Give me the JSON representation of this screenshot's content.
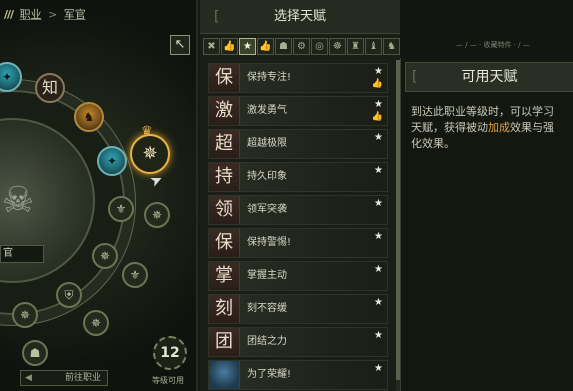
{
  "breadcrumb": {
    "prefix": "///",
    "level1": "职业",
    "separator": ">",
    "level2": "军官"
  },
  "wheel": {
    "rank_label": "官",
    "level_badge": "12",
    "level_caption": "等级可用",
    "prev_button": "前往职业",
    "nodes": {
      "know": "知"
    }
  },
  "choose_panel": {
    "title": "选择天赋",
    "sort_label": "— / — · 收藏特件 · / —",
    "filters": [
      "✖",
      "👍",
      "★",
      "👍",
      "☗",
      "⚙",
      "◎",
      "☸",
      "♜",
      "♝",
      "♞"
    ],
    "talents": [
      {
        "glyph": "保",
        "name": "保持专注!",
        "star": true,
        "thumb": true
      },
      {
        "glyph": "激",
        "name": "激发勇气",
        "star": true,
        "thumb": true
      },
      {
        "glyph": "超",
        "name": "超越极限",
        "star": true,
        "thumb": false
      },
      {
        "glyph": "持",
        "name": "持久印象",
        "star": true,
        "thumb": false
      },
      {
        "glyph": "领",
        "name": "领军突袭",
        "star": true,
        "thumb": false
      },
      {
        "glyph": "保",
        "name": "保持警惕!",
        "star": true,
        "thumb": false
      },
      {
        "glyph": "掌",
        "name": "掌握主动",
        "star": true,
        "thumb": false
      },
      {
        "glyph": "刻",
        "name": "刻不容缓",
        "star": true,
        "thumb": false
      },
      {
        "glyph": "团",
        "name": "团结之力",
        "star": true,
        "thumb": false
      },
      {
        "glyph": "",
        "name": "为了荣耀!",
        "star": true,
        "thumb": false
      }
    ]
  },
  "avail_panel": {
    "title": "可用天赋",
    "text_a": "到达此职业等级时，可以学习",
    "text_b": "天赋，获得被动",
    "text_hl": "加成",
    "text_c": "效果与强",
    "text_d": "化效果。"
  }
}
